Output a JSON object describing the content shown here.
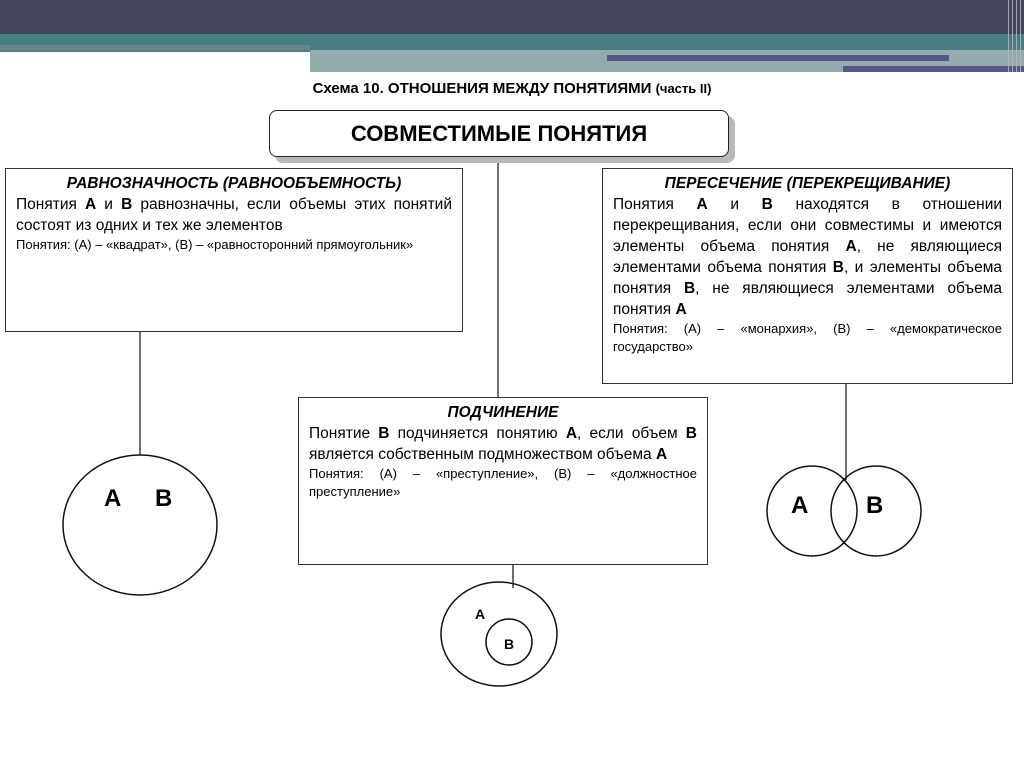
{
  "slide": {
    "title_main": "Схема 10. ОТНОШЕНИЯ МЕЖДУ ПОНЯТИЯМИ",
    "title_sub": "(часть II)",
    "root_label": "СОВМЕСТИМЫЕ ПОНЯТИЯ"
  },
  "equivalence": {
    "heading": "РАВНОЗНАЧНОСТЬ (РАВНООБЪЕМНОСТЬ)",
    "body_parts": [
      "Понятия ",
      "А",
      " и ",
      "В",
      " равнозначны, если объемы этих понятий состоят из одних и тех же элементов"
    ],
    "example": "Понятия: (А) – «квадрат», (В) – «равносторонний прямоугольник»",
    "diagram_labels": [
      "А",
      "В"
    ]
  },
  "intersection": {
    "heading": "ПЕРЕСЕЧЕНИЕ (ПЕРЕКРЕЩИВАНИЕ)",
    "body_parts": [
      "Понятия ",
      "А",
      " и ",
      "В",
      " находятся в отношении перекрещивания, если они совместимы и имеются элементы объема понятия ",
      "А",
      ", не являющиеся элементами объема понятия ",
      "В",
      ", и элементы объема понятия ",
      "В",
      ", не являющиеся элементами объема понятия ",
      "А"
    ],
    "example": "Понятия: (А) – «монархия», (В) – «демократическое государство»",
    "diagram_labels": [
      "А",
      "В"
    ]
  },
  "subordination": {
    "heading": "ПОДЧИНЕНИЕ",
    "body_parts": [
      "Понятие ",
      "В",
      " подчиняется понятию ",
      "А",
      ", если объем ",
      "В",
      " является собственным подмножеством объема ",
      "А"
    ],
    "example": "Понятия: (А) – «преступление», (В) – «должностное преступление»",
    "diagram_labels": [
      "А",
      "В"
    ]
  }
}
